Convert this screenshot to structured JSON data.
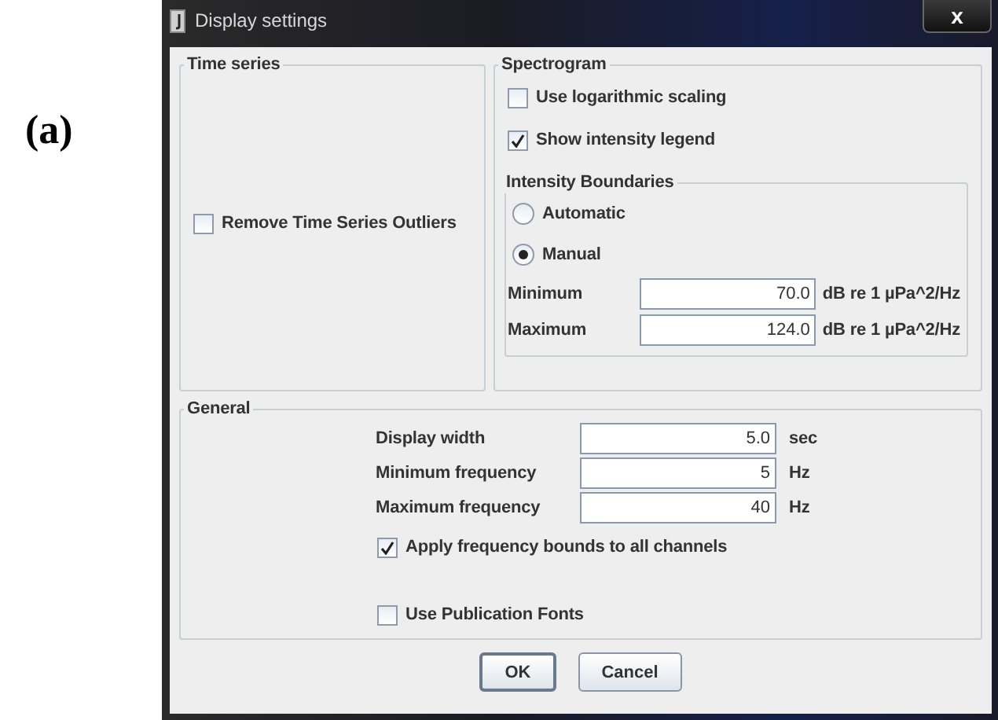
{
  "figure_label": "(a)",
  "window": {
    "title": "Display settings",
    "close": "x"
  },
  "time_series": {
    "title": "Time series",
    "checkboxes": [
      {
        "label": "Remove Time Series Outliers",
        "checked": false
      }
    ]
  },
  "spectrogram": {
    "title": "Spectrogram",
    "checkboxes": [
      {
        "label": "Use logarithmic scaling",
        "checked": false
      },
      {
        "label": "Show intensity legend",
        "checked": true
      }
    ],
    "intensity_boundaries": {
      "title": "Intensity Boundaries",
      "options": [
        {
          "label": "Automatic",
          "selected": false
        },
        {
          "label": "Manual",
          "selected": true
        }
      ],
      "fields": [
        {
          "label": "Minimum",
          "value": "70.0",
          "unit": "dB re 1 µPa^2/Hz"
        },
        {
          "label": "Maximum",
          "value": "124.0",
          "unit": "dB re 1 µPa^2/Hz"
        }
      ]
    }
  },
  "general": {
    "title": "General",
    "fields": [
      {
        "label": "Display width",
        "value": "5.0",
        "unit": "sec"
      },
      {
        "label": "Minimum frequency",
        "value": "5",
        "unit": "Hz"
      },
      {
        "label": "Maximum frequency",
        "value": "40",
        "unit": "Hz"
      }
    ],
    "checkboxes": [
      {
        "label": "Apply frequency bounds to all channels",
        "checked": true
      },
      {
        "label": "Use Publication Fonts",
        "checked": false
      }
    ]
  },
  "buttons": [
    "OK",
    "Cancel"
  ]
}
